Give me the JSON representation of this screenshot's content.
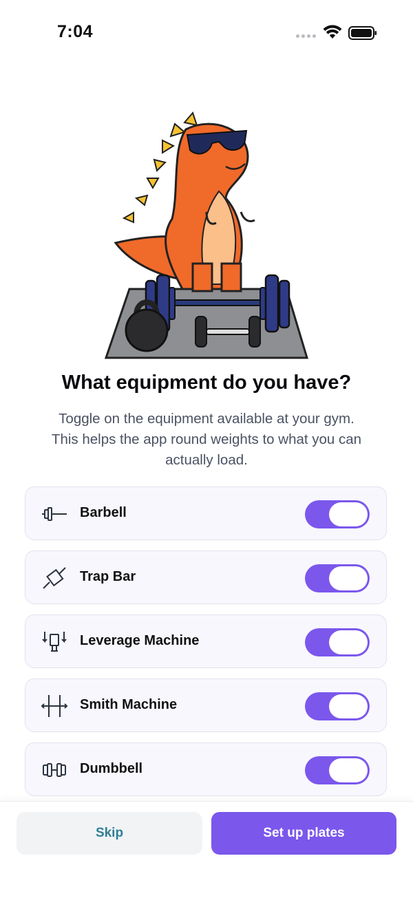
{
  "status_bar": {
    "time": "7:04"
  },
  "heading": {
    "title": "What equipment do you have?",
    "subtitle_line1": "Toggle on the equipment available at your gym.",
    "subtitle_line2": "This helps the app round weights to what you can",
    "subtitle_line3": "actually load."
  },
  "equipment": [
    {
      "label": "Barbell",
      "icon": "barbell-icon",
      "enabled": true
    },
    {
      "label": "Trap Bar",
      "icon": "trap-bar-icon",
      "enabled": true
    },
    {
      "label": "Leverage Machine",
      "icon": "leverage-machine-icon",
      "enabled": true
    },
    {
      "label": "Smith Machine",
      "icon": "smith-machine-icon",
      "enabled": true
    },
    {
      "label": "Dumbbell",
      "icon": "dumbbell-icon",
      "enabled": true
    }
  ],
  "footer": {
    "skip_label": "Skip",
    "primary_label": "Set up plates"
  },
  "colors": {
    "accent": "#7b57ec",
    "skip_text": "#2f7f96",
    "card_bg": "#f8f7fd",
    "card_border": "#e3e2ee"
  }
}
